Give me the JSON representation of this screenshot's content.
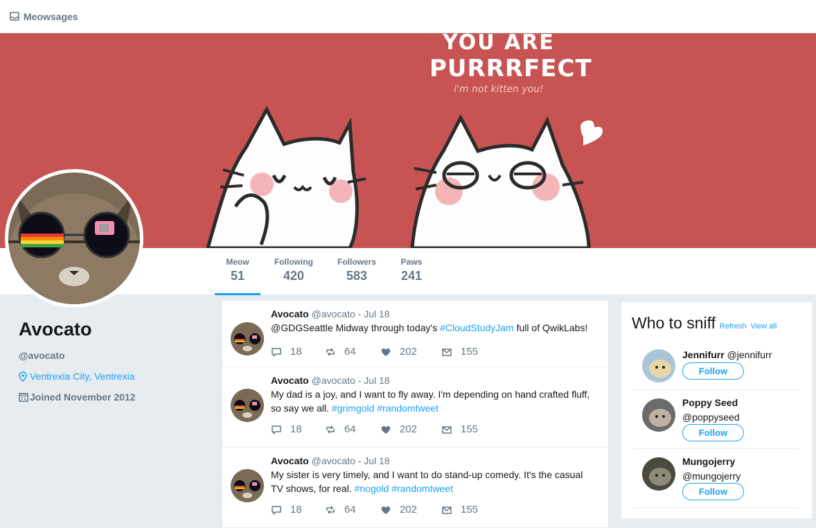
{
  "app": {
    "title": "Meowsages",
    "icon": "inbox-icon"
  },
  "banner": {
    "line1": "YOU ARE",
    "line2": "PURRRFECT",
    "line3": "i'm not kitten you!",
    "bg_color": "#c85353"
  },
  "stats": [
    {
      "label": "Meow",
      "value": "51"
    },
    {
      "label": "Following",
      "value": "420"
    },
    {
      "label": "Followers",
      "value": "583"
    },
    {
      "label": "Paws",
      "value": "241"
    }
  ],
  "profile": {
    "name": "Avocato",
    "handle": "@avocato",
    "location": "Ventrexia City, Ventrexia",
    "joined": "Joined November 2012"
  },
  "tweets": [
    {
      "name": "Avocato",
      "handle": "@avocato",
      "date": "- Jul 18",
      "text_parts": [
        {
          "t": "@GDGSeattle Midway through today's ",
          "tag": false
        },
        {
          "t": "#CloudStudyJam",
          "tag": true
        },
        {
          "t": " full of QwikLabs!",
          "tag": false
        }
      ],
      "replies": "18",
      "retweets": "64",
      "likes": "202",
      "messages": "155"
    },
    {
      "name": "Avocato",
      "handle": "@avocato",
      "date": "- Jul 18",
      "text_parts": [
        {
          "t": "My dad is a joy, and I want to fly away. I'm depending on hand crafted fluff, so say we all. ",
          "tag": false
        },
        {
          "t": "#grimgold",
          "tag": true
        },
        {
          "t": " ",
          "tag": false
        },
        {
          "t": "#randomtweet",
          "tag": true
        }
      ],
      "replies": "18",
      "retweets": "64",
      "likes": "202",
      "messages": "155"
    },
    {
      "name": "Avocato",
      "handle": "@avocato",
      "date": "- Jul 18",
      "text_parts": [
        {
          "t": "My sister is very timely, and I want to do stand-up comedy. It's the casual TV shows, for real. ",
          "tag": false
        },
        {
          "t": "#nogold",
          "tag": true
        },
        {
          "t": " ",
          "tag": false
        },
        {
          "t": "#randomtweet",
          "tag": true
        }
      ],
      "replies": "18",
      "retweets": "64",
      "likes": "202",
      "messages": "155"
    }
  ],
  "who_to_sniff": {
    "title": "Who to sniff",
    "refresh": "Refresh",
    "view_all": "View all",
    "follow_label": "Follow",
    "suggestions": [
      {
        "name": "Jennifurr",
        "handle": "@jennifurr"
      },
      {
        "name": "Poppy Seed",
        "handle": "@poppyseed"
      },
      {
        "name": "Mungojerry",
        "handle": "@mungojerry"
      }
    ]
  },
  "colors": {
    "accent": "#1da1f2",
    "muted": "#657786",
    "page_bg": "#e6ecf0"
  }
}
